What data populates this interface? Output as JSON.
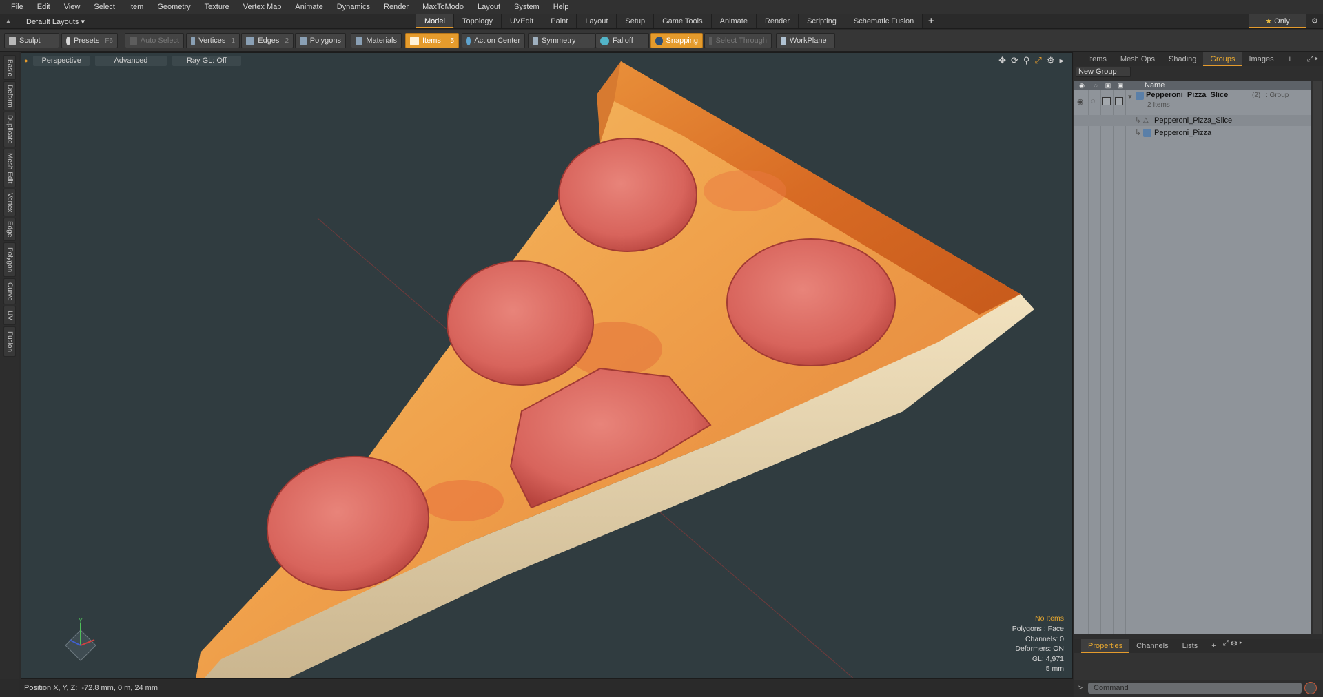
{
  "menu": [
    "File",
    "Edit",
    "View",
    "Select",
    "Item",
    "Geometry",
    "Texture",
    "Vertex Map",
    "Animate",
    "Dynamics",
    "Render",
    "MaxToModo",
    "Layout",
    "System",
    "Help"
  ],
  "layout_bar": {
    "layouts_label": "Default Layouts",
    "tabs": [
      "Model",
      "Topology",
      "UVEdit",
      "Paint",
      "Layout",
      "Setup",
      "Game Tools",
      "Animate",
      "Render",
      "Scripting",
      "Schematic Fusion"
    ],
    "active_tab": "Model",
    "only_label": "Only",
    "add_label": "+"
  },
  "toolbar": {
    "sculpt": "Sculpt",
    "presets": "Presets",
    "presets_key": "F6",
    "auto_select": "Auto Select",
    "vertices": "Vertices",
    "vertices_key": "1",
    "edges": "Edges",
    "edges_key": "2",
    "polygons": "Polygons",
    "materials": "Materials",
    "items": "Items",
    "items_key": "5",
    "action_center": "Action Center",
    "symmetry": "Symmetry",
    "falloff": "Falloff",
    "snapping": "Snapping",
    "select_through": "Select Through",
    "workplane": "WorkPlane"
  },
  "left_tabs": [
    "Basic",
    "Deform",
    "Duplicate",
    "Mesh Edit",
    "Vertex",
    "Edge",
    "Polygon",
    "Curve",
    "UV",
    "Fusion"
  ],
  "viewport": {
    "view_label": "Perspective",
    "shading_label": "Advanced",
    "raygl_label": "Ray GL: Off",
    "stats": {
      "items": "No Items",
      "polygons": "Polygons : Face",
      "channels": "Channels: 0",
      "deformers": "Deformers: ON",
      "gl": "GL: 4,971",
      "scale": "5 mm"
    },
    "axis_y_label": "Y"
  },
  "statusbar": {
    "position_label": "Position X, Y, Z:",
    "position_value": "-72.8 mm, 0 m, 24 mm"
  },
  "right_panel": {
    "tabs": [
      "Items",
      "Mesh Ops",
      "Shading",
      "Groups",
      "Images"
    ],
    "active_tab": "Groups",
    "add_label": "+",
    "new_group": "New Group",
    "name_header": "Name",
    "group": {
      "name": "Pepperoni_Pizza_Slice",
      "count": "(2)",
      "type": ": Group",
      "items_count": "2 Items"
    },
    "children": [
      "Pepperoni_Pizza_Slice",
      "Pepperoni_Pizza"
    ],
    "bottom_tabs": [
      "Properties",
      "Channels",
      "Lists"
    ],
    "bottom_active": "Properties",
    "command_placeholder": "Command"
  },
  "colors": {
    "accent": "#e59b2c",
    "viewport_bg": "#303c40",
    "list_bg": "#8f949a"
  }
}
